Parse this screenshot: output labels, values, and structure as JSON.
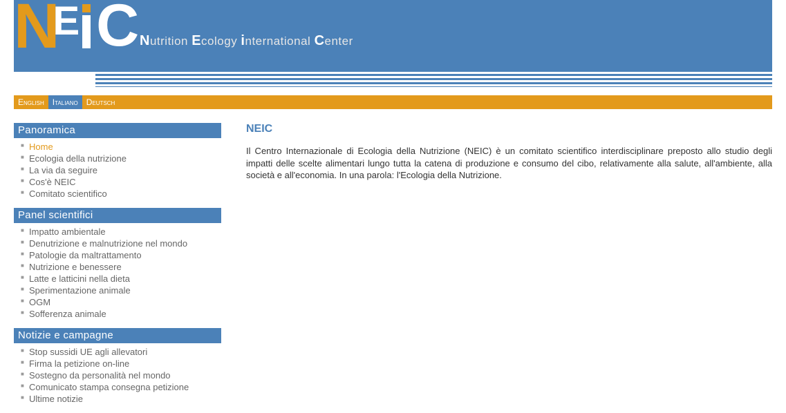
{
  "header": {
    "tagline_parts": {
      "n": "N",
      "nutrition": "utrition ",
      "e": "E",
      "ecology": "cology ",
      "i": "i",
      "international": "nternational ",
      "c": "C",
      "center": "enter"
    }
  },
  "languages": [
    {
      "label": "English",
      "active": false
    },
    {
      "label": "Italiano",
      "active": true
    },
    {
      "label": "Deutsch",
      "active": false
    }
  ],
  "sidebar": {
    "sections": [
      {
        "title": "Panoramica",
        "items": [
          {
            "label": "Home",
            "active": true
          },
          {
            "label": "Ecologia della nutrizione"
          },
          {
            "label": "La via da seguire"
          },
          {
            "label": "Cos'è NEIC"
          },
          {
            "label": "Comitato scientifico"
          }
        ]
      },
      {
        "title": "Panel scientifici",
        "items": [
          {
            "label": "Impatto ambientale"
          },
          {
            "label": "Denutrizione e malnutrizione nel mondo"
          },
          {
            "label": "Patologie da maltrattamento"
          },
          {
            "label": "Nutrizione e benessere"
          },
          {
            "label": "Latte e latticini nella dieta"
          },
          {
            "label": "Sperimentazione animale"
          },
          {
            "label": "OGM"
          },
          {
            "label": "Sofferenza animale"
          }
        ]
      },
      {
        "title": "Notizie e campagne",
        "items": [
          {
            "label": "Stop sussidi UE agli allevatori"
          },
          {
            "label": "Firma la petizione on-line"
          },
          {
            "label": "Sostegno da personalità nel mondo"
          },
          {
            "label": "Comunicato stampa consegna petizione"
          },
          {
            "label": "Ultime notizie"
          }
        ]
      }
    ]
  },
  "main": {
    "title": "NEIC",
    "body": "Il Centro Internazionale di Ecologia della Nutrizione (NEIC) è un comitato scientifico interdisciplinare preposto allo studio degli impatti delle scelte alimentari lungo tutta la catena di produzione e consumo del cibo, relativamente alla salute, all'ambiente, alla società e all'economia. In una parola: l'Ecologia della Nutrizione."
  }
}
